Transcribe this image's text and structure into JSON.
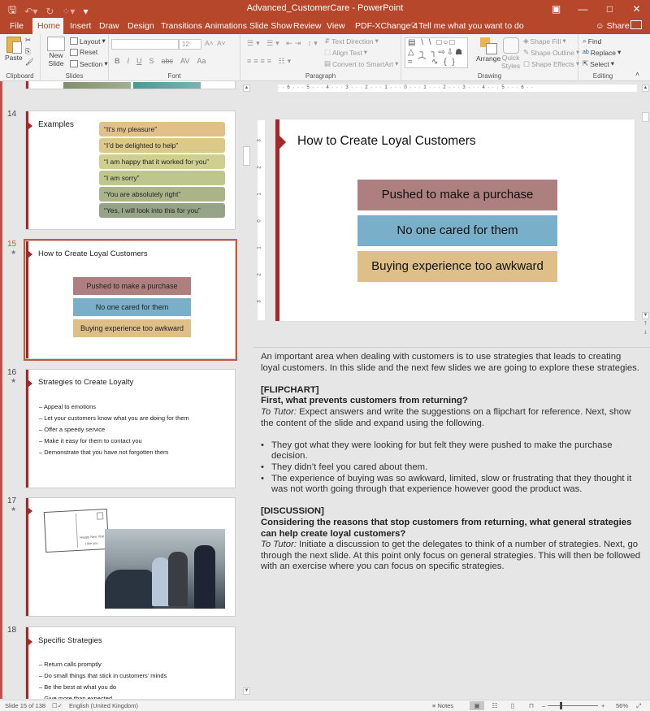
{
  "titlebar": {
    "title": "Advanced_CustomerCare - PowerPoint",
    "qat": {
      "save_icon": "save-icon",
      "undo_icon": "undo-icon",
      "redo_icon": "redo-icon",
      "customize_icon": "customize-qat-icon"
    },
    "window_controls": {
      "ribbon_display": "▣",
      "minimize": "—",
      "maximize": "□",
      "close": "✕"
    }
  },
  "tabs": [
    {
      "label": "File"
    },
    {
      "label": "Home",
      "active": true
    },
    {
      "label": "Insert"
    },
    {
      "label": "Draw"
    },
    {
      "label": "Design"
    },
    {
      "label": "Transitions"
    },
    {
      "label": "Animations"
    },
    {
      "label": "Slide Show"
    },
    {
      "label": "Review"
    },
    {
      "label": "View"
    },
    {
      "label": "PDF-XChange 4"
    }
  ],
  "tell_me": "Tell me what you want to do",
  "share": "Share",
  "ribbon": {
    "clipboard": {
      "label": "Clipboard",
      "paste": "Paste"
    },
    "slides": {
      "label": "Slides",
      "new_slide_1": "New",
      "new_slide_2": "Slide",
      "layout": "Layout",
      "reset": "Reset",
      "section": "Section"
    },
    "font": {
      "label": "Font",
      "font_name": "",
      "font_size": "12",
      "format_buttons": [
        "B",
        "I",
        "U",
        "S",
        "abc",
        "AV",
        "Aa"
      ]
    },
    "paragraph": {
      "label": "Paragraph",
      "text_direction": "Text Direction",
      "align_text": "Align Text",
      "convert_smartart": "Convert to SmartArt"
    },
    "drawing": {
      "label": "Drawing",
      "shapes_row1": "▤ \\ \\ □○□",
      "shapes_row2": "△ ┐ ┐⇨⇩☗",
      "shapes_row3": "≈ ⌒ ∿ { } ☆",
      "arrange": "Arrange",
      "quick_styles_1": "Quick",
      "quick_styles_2": "Styles",
      "shape_fill": "Shape Fill",
      "shape_outline": "Shape Outline",
      "shape_effects": "Shape Effects"
    },
    "editing": {
      "label": "Editing",
      "find": "Find",
      "replace": "Replace",
      "select": "Select"
    }
  },
  "thumbnails": [
    {
      "number": "14",
      "title": "Examples",
      "starred": false,
      "items": [
        {
          "text": "“It’s my pleasure”",
          "color": "#e3c08a"
        },
        {
          "text": "“I’d be delighted to help”",
          "color": "#dcc98a"
        },
        {
          "text": "“I am happy that it worked for you”",
          "color": "#cfcf8f"
        },
        {
          "text": "“I am sorry”",
          "color": "#bfc68d"
        },
        {
          "text": "“You are absolutely right”",
          "color": "#a9b589"
        },
        {
          "text": "“Yes, I will look into this for you”",
          "color": "#95a486"
        }
      ]
    },
    {
      "number": "15",
      "title": "How to Create Loyal Customers",
      "starred": true,
      "selected": true,
      "boxes": [
        {
          "text": "Pushed to make a purchase",
          "color": "#ad7f7f"
        },
        {
          "text": "No one cared for them",
          "color": "#7aafc9"
        },
        {
          "text": "Buying experience too awkward",
          "color": "#dfbf88"
        }
      ]
    },
    {
      "number": "16",
      "title": "Strategies to Create Loyalty",
      "starred": true,
      "bullets": [
        "– Appeal to emotions",
        "– Let your customers know what you are doing for them",
        "– Offer a speedy service",
        "– Make it easy for them to contact you",
        "– Demonstrate that you have not forgotten them"
      ]
    },
    {
      "number": "17",
      "starred": true,
      "postcard_line1": "Happy New Year",
      "postcard_line2": "I like you"
    },
    {
      "number": "18",
      "title": "Specific Strategies",
      "starred": false,
      "bullets": [
        "– Return calls promptly",
        "– Do small things that stick in customers’ minds",
        "– Be the best at what you do",
        "– Give more than expected"
      ]
    }
  ],
  "star": "★",
  "main_slide": {
    "title": "How to Create Loyal Customers",
    "boxes": [
      {
        "text": "Pushed to make a purchase",
        "color": "#ad7f7f"
      },
      {
        "text": "No one cared for them",
        "color": "#7aafc9"
      },
      {
        "text": "Buying experience too awkward",
        "color": "#dfbf88"
      }
    ],
    "hruler": "· · 6 · · · 5 · · · 4 · · · 3 · · · 2 · · · 1 · · · 0 · · · 1 · · · 2 · · · 3 · · · 4 · · · 5 · · · 6 · ·",
    "vruler": [
      "3",
      "2",
      "1",
      "0",
      "1",
      "2",
      "3"
    ]
  },
  "notes": {
    "intro": "An important area when dealing with customers is to use strategies that leads to creating loyal customers. In this slide and the next few slides we are going to explore these strategies.",
    "section1_tag": "[FLIPCHART]",
    "section1_question": "First, what prevents customers from returning?",
    "section1_tutor_label": "To Tutor:",
    "section1_tutor_text": " Expect answers and write the suggestions on a flipchart for reference. Next, show the content of the slide and expand using the following.",
    "bullets": [
      "They got what they were looking for but felt they were pushed to make the purchase decision.",
      "They didn’t feel you cared about them.",
      "The experience of buying was so awkward, limited, slow or frustrating that they thought it was not worth going through that experience however good the product was."
    ],
    "section2_tag": "[DISCUSSION]",
    "section2_question": "Considering the reasons that stop customers from returning, what general strategies can help create loyal customers?",
    "section2_tutor_label": "To Tutor:",
    "section2_tutor_text": " Initiate a discussion to get the delegates to think of a number of strategies. Next, go through the next slide. At this point only focus on general strategies. This will then be followed with an exercise where you can focus on specific strategies."
  },
  "statusbar": {
    "slide_count": "Slide 15 of 138",
    "language": "English (United Kingdom)",
    "notes": "Notes",
    "zoom": "56%",
    "zoom_percent": 56
  }
}
